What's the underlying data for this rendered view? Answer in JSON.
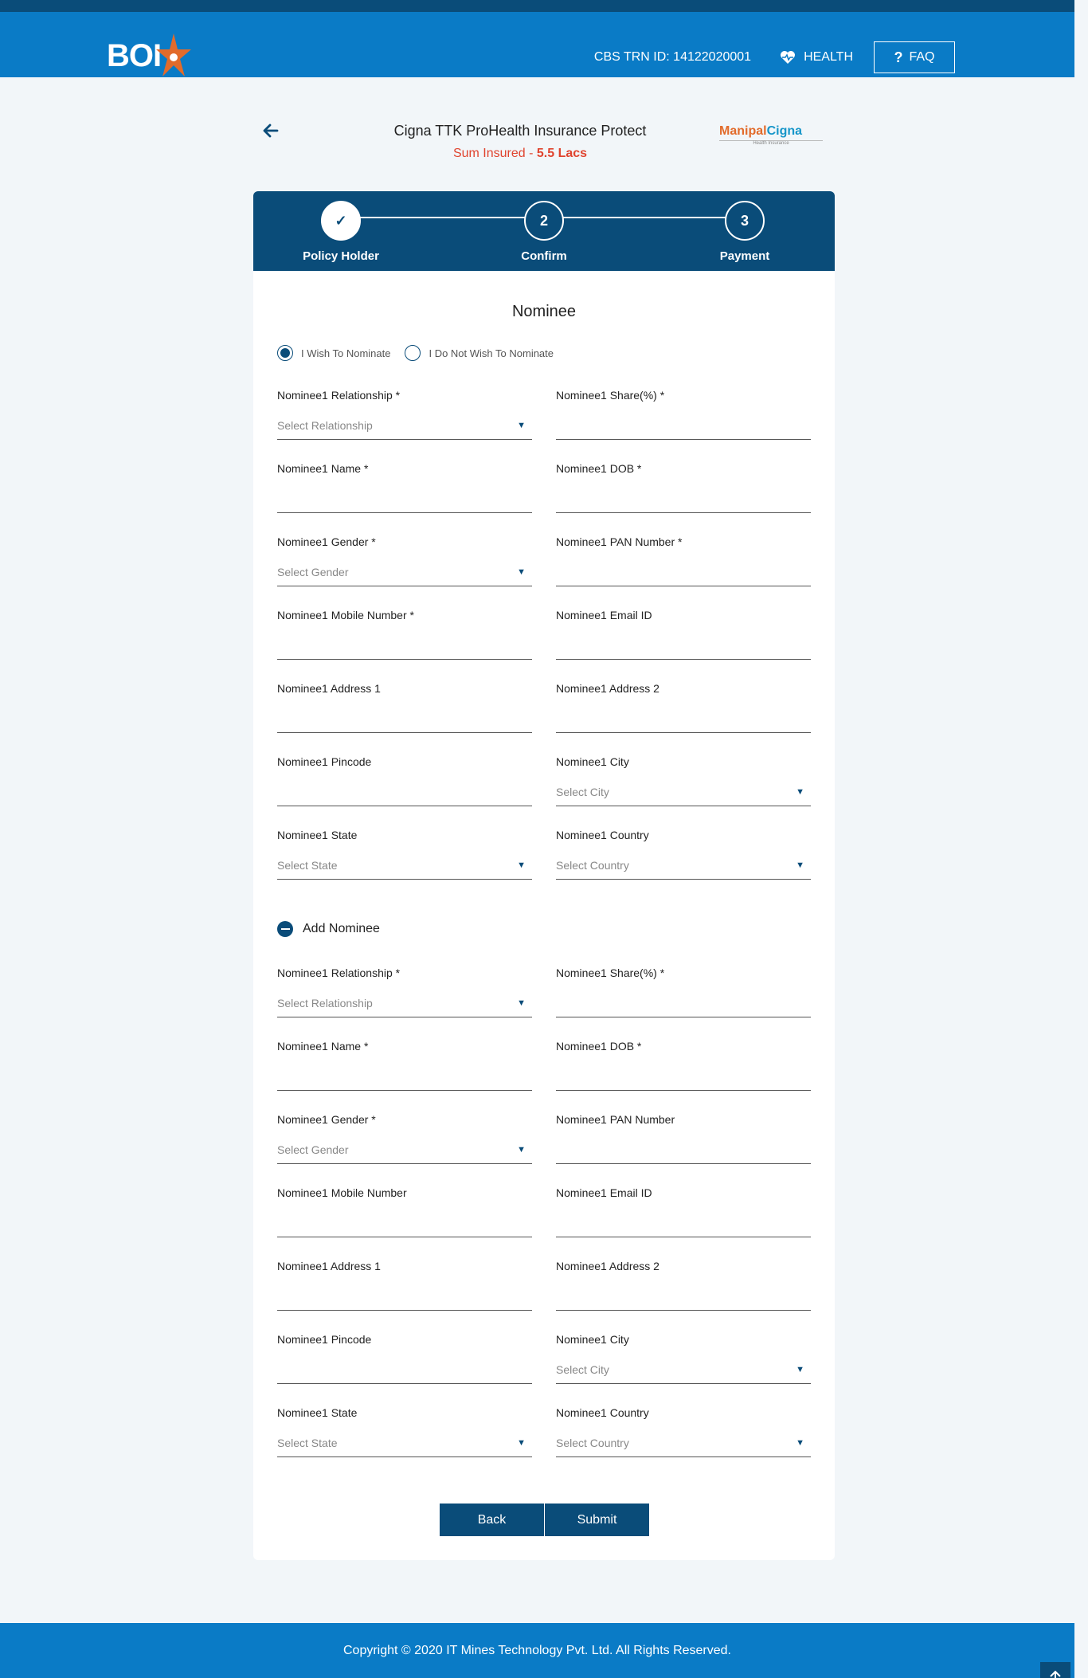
{
  "header": {
    "logo_text": "BOI",
    "cbs_trn": "CBS TRN ID: 14122020001",
    "health_label": "HEALTH",
    "faq_label": "FAQ",
    "faq_symbol": "?"
  },
  "product": {
    "title": "Cigna TTK ProHealth Insurance Protect",
    "sum_label": "Sum Insured - ",
    "sum_value": "5.5 Lacs",
    "insurer_logo_text_1": "Manipal",
    "insurer_logo_text_2": "Cigna",
    "insurer_logo_sub": "Health Insurance"
  },
  "stepper": {
    "steps": [
      {
        "label": "Policy Holder",
        "number": "✓"
      },
      {
        "label": "Confirm",
        "number": "2"
      },
      {
        "label": "Payment",
        "number": "3"
      }
    ]
  },
  "form": {
    "section_title": "Nominee",
    "radio_yes": "I Wish To Nominate",
    "radio_no": "I Do Not Wish To Nominate",
    "add_nominee": "Add Nominee",
    "nominee_1": {
      "relationship_label": "Nominee1 Relationship *",
      "relationship_placeholder": "Select Relationship",
      "share_label": "Nominee1 Share(%) *",
      "name_label": "Nominee1 Name *",
      "dob_label": "Nominee1 DOB *",
      "gender_label": "Nominee1 Gender *",
      "gender_placeholder": "Select Gender",
      "pan_label": "Nominee1 PAN Number *",
      "mobile_label": "Nominee1 Mobile Number *",
      "email_label": "Nominee1 Email ID",
      "address1_label": "Nominee1 Address 1",
      "address2_label": "Nominee1 Address 2",
      "pincode_label": "Nominee1 Pincode",
      "city_label": "Nominee1 City",
      "city_placeholder": "Select City",
      "state_label": "Nominee1 State",
      "state_placeholder": "Select State",
      "country_label": "Nominee1 Country",
      "country_placeholder": "Select Country"
    },
    "nominee_2": {
      "relationship_label": "Nominee1 Relationship *",
      "relationship_placeholder": "Select Relationship",
      "share_label": "Nominee1 Share(%) *",
      "name_label": "Nominee1 Name *",
      "dob_label": "Nominee1 DOB *",
      "gender_label": "Nominee1 Gender *",
      "gender_placeholder": "Select Gender",
      "pan_label": "Nominee1 PAN Number",
      "mobile_label": "Nominee1 Mobile Number",
      "email_label": "Nominee1 Email ID",
      "address1_label": "Nominee1 Address 1",
      "address2_label": "Nominee1 Address 2",
      "pincode_label": "Nominee1 Pincode",
      "city_label": "Nominee1 City",
      "city_placeholder": "Select City",
      "state_label": "Nominee1 State",
      "state_placeholder": "Select State",
      "country_label": "Nominee1 Country",
      "country_placeholder": "Select Country"
    },
    "back_label": "Back",
    "submit_label": "Submit"
  },
  "footer": {
    "copyright": "Copyright © 2020 IT Mines Technology Pvt. Ltd. All Rights Reserved."
  },
  "colors": {
    "header_blue": "#0a7bc6",
    "dark_navy": "#0a4c79",
    "accent_red": "#e0442f"
  }
}
